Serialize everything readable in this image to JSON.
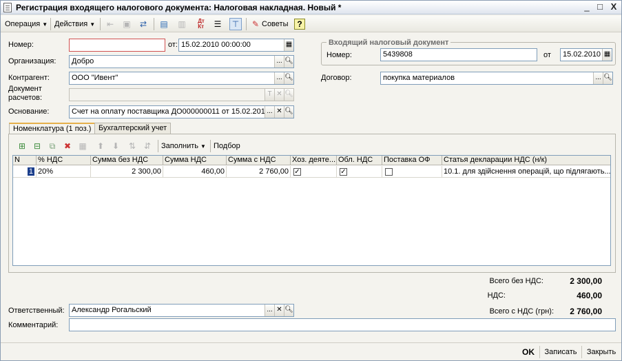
{
  "window": {
    "title": "Регистрация входящего налогового документа: Налоговая накладная. Новый *",
    "min": "_",
    "max": "□",
    "close": "X"
  },
  "toolbar": {
    "operation": "Операция",
    "actions": "Действия",
    "advice": "Советы",
    "help": "?"
  },
  "form": {
    "number_label": "Номер:",
    "number_value": "",
    "from_label": "от:",
    "date_value": "15.02.2010 00:00:00",
    "org_label": "Организация:",
    "org_value": "Добро",
    "contractor_label": "Контрагент:",
    "contractor_value": "ООО \"Ивент\"",
    "settlement_label_1": "Документ",
    "settlement_label_2": "расчетов:",
    "settlement_value": "",
    "basis_label": "Основание:",
    "basis_value": "Счет на оплату поставщика ДО000000011 от 15.02.2010"
  },
  "incoming": {
    "group_title": "Входящий налоговый документ",
    "number_label": "Номер:",
    "number_value": "5439808",
    "from_label": "от",
    "date_value": "15.02.2010",
    "contract_label": "Договор:",
    "contract_value": "покупка материалов"
  },
  "tabs": [
    {
      "label": "Номенклатура (1 поз.)"
    },
    {
      "label": "Бухгалтерский учет"
    }
  ],
  "grid_toolbar": {
    "fill": "Заполнить",
    "select": "Подбор"
  },
  "table": {
    "columns": [
      "N",
      "% НДС",
      "Сумма без НДС",
      "Сумма НДС",
      "Сумма с НДС",
      "Хоз. деяте...",
      "Обл. НДС",
      "Поставка ОФ",
      "Статья декларации НДС (н/к)"
    ],
    "rows": [
      {
        "n": "1",
        "vat_rate": "20%",
        "sum_no_vat": "2 300,00",
        "vat_sum": "460,00",
        "sum_with_vat": "2 760,00",
        "econ_activity": true,
        "vat_taxable": true,
        "fixed_asset": false,
        "declaration_item": "10.1. для здійснення операцій, що підлягають..."
      }
    ]
  },
  "totals": {
    "no_vat_label": "Всего без НДС:",
    "no_vat_value": "2 300,00",
    "vat_label": "НДС:",
    "vat_value": "460,00",
    "with_vat_label": "Всего с НДС (грн):",
    "with_vat_value": "2 760,00"
  },
  "footer": {
    "responsible_label": "Ответственный:",
    "responsible_value": "Александр Рогальский",
    "comment_label": "Комментарий:",
    "comment_value": ""
  },
  "buttons": {
    "ok": "OK",
    "save": "Записать",
    "close": "Закрыть"
  }
}
